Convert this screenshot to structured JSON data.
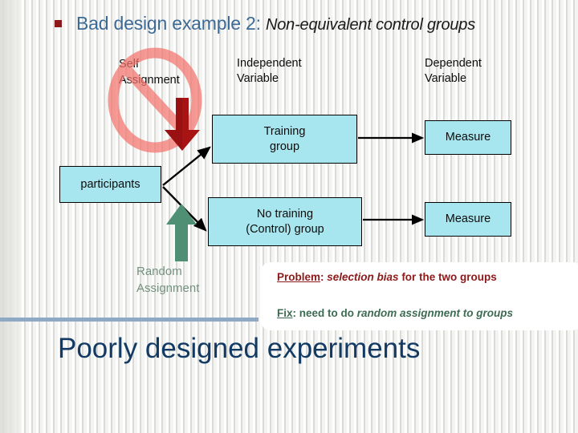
{
  "slide": {
    "header": {
      "bullet": "square-bullet",
      "title_plain": "Bad design example 2: ",
      "title_italic": "Non-equivalent control groups"
    },
    "diagram": {
      "column_labels": {
        "independent_variable": "Independent\nVariable",
        "dependent_variable": "Dependent\nVariable"
      },
      "self_assignment_label": "Self\nAssignment",
      "no_sign": "prohibition-sign",
      "down_arrow": "down-arrow-icon",
      "up_arrow": "up-arrow-icon",
      "boxes": {
        "participants": "participants",
        "training_group": "Training\ngroup",
        "control_group": "No training\n(Control) group",
        "measure_top": "Measure",
        "measure_bottom": "Measure"
      },
      "random_assignment_label": "Random\nAssignment"
    },
    "callout": {
      "problem": {
        "lead": "Problem",
        "separator": ": ",
        "emphasis": "selection bias",
        "tail": " for the two groups"
      },
      "fix": {
        "lead": "Fix",
        "separator": ": need to do ",
        "emphasis": "random assignment to groups",
        "tail": ""
      }
    },
    "footer_title": "Poorly designed experiments",
    "colors": {
      "box_fill": "#a8e6ef",
      "header_text": "#3c6a96",
      "bullet": "#8c1a1a",
      "problem_text": "#8c1a1a",
      "fix_text": "#3e6b54",
      "random_assignment_text": "#74917f",
      "footer_title": "#123a63",
      "divider": "#8fa8c4",
      "no_sign": "#f4746e",
      "down_arrow": "#a81414",
      "up_arrow": "#4f8f74"
    }
  }
}
